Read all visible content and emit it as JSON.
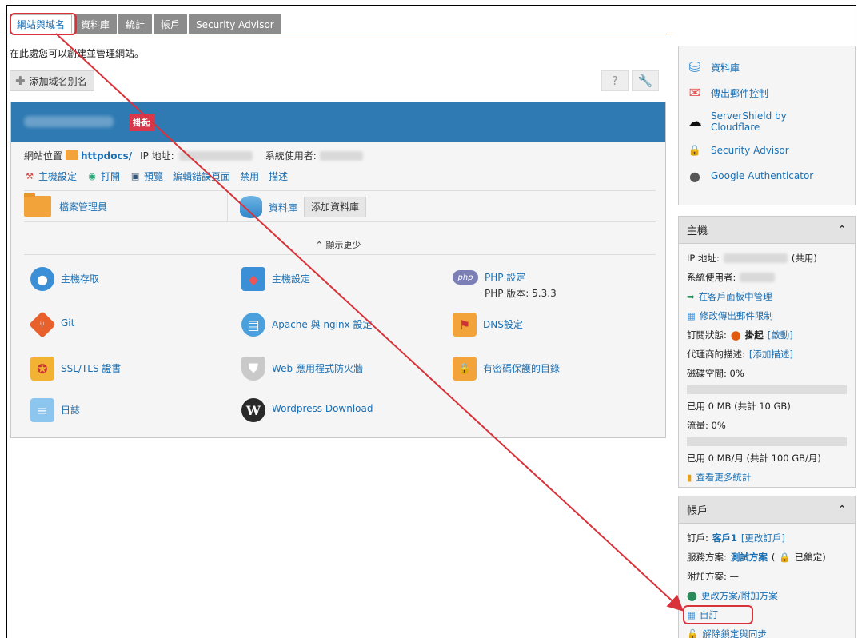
{
  "tabs": [
    "網站與域名",
    "資料庫",
    "統計",
    "帳戶",
    "Security Advisor"
  ],
  "intro": "在此處您可以創建並管理網站。",
  "add_alias": "添加域名別名",
  "domain": {
    "status_badge": "掛起",
    "site_location_label": "網站位置",
    "site_location_value": "httpdocs/",
    "ip_label": "IP 地址:",
    "sys_user_label": "系統使用者:",
    "actions": [
      "主機設定",
      "打開",
      "預覽",
      "編輯錯誤頁面",
      "禁用",
      "描述"
    ],
    "file_manager": "檔案管理員",
    "database": "資料庫",
    "add_database": "添加資料庫",
    "show_less": "顯示更少",
    "tools": {
      "hosting_access": "主機存取",
      "hosting_settings": "主機設定",
      "php_settings": "PHP 設定",
      "php_version": "PHP 版本: 5.3.3",
      "git": "Git",
      "apache_nginx": "Apache 與 nginx 設定",
      "dns": "DNS設定",
      "ssl": "SSL/TLS 證書",
      "waf": "Web 應用程式防火牆",
      "protected_dirs": "有密碼保護的目錄",
      "logs": "日誌",
      "wordpress": "Wordpress Download"
    }
  },
  "extensions": [
    "資料庫",
    "傳出郵件控制",
    "ServerShield by Cloudflare",
    "Security Advisor",
    "Google Authenticator"
  ],
  "hosting_box": {
    "title": "主機",
    "ip_label": "IP 地址:",
    "shared": "(共用)",
    "sys_user": "系統使用者:",
    "manage_link": "在客戶面板中管理",
    "limit_link": "修改傳出郵件限制",
    "sub_status_label": "訂閱狀態:",
    "sub_status": "掛起",
    "enable": "[啟動]",
    "reseller_desc_label": "代理商的描述:",
    "add_desc": "[添加描述]",
    "disk_label": "磁碟空間: 0%",
    "disk_used": "已用 0 MB (共計 10 GB)",
    "traffic_label": "流量: 0%",
    "traffic_used": "已用 0 MB/月 (共計 100 GB/月)",
    "more_stats": "查看更多統計",
    "disk_percent": 0,
    "traffic_percent": 0
  },
  "account_box": {
    "title": "帳戶",
    "subscription_label": "訂戶:",
    "customer": "客戶1",
    "change_customer": "[更改訂戶]",
    "plan_label": "服務方案:",
    "plan": "測試方案",
    "plan_open": "(",
    "locked": "已鎖定)",
    "addon_label": "附加方案: —",
    "change_plan": "更改方案/附加方案",
    "customize": "自訂",
    "unlock_sync": "解除鎖定與同步"
  }
}
